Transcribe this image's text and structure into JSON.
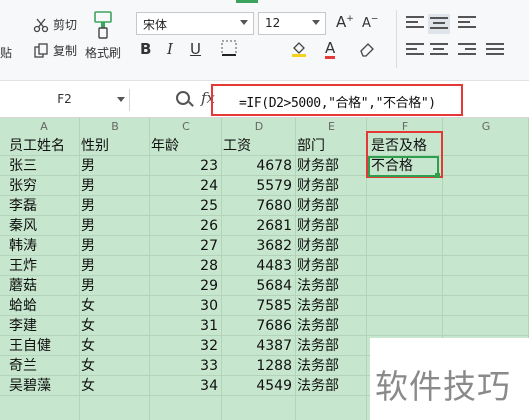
{
  "ribbon": {
    "paste_label": "贴",
    "cut_label": "剪切",
    "copy_label": "复制",
    "format_painter_label": "格式刷",
    "font_name": "宋体",
    "font_size": "12",
    "accent_color": "#e53935",
    "green_accent": "#3ca35c"
  },
  "formula_bar": {
    "name_box": "F2",
    "fx_label": "fx",
    "formula": "=IF(D2>5000,\"合格\",\"不合格\")"
  },
  "columns": [
    "A",
    "B",
    "C",
    "D",
    "E",
    "F",
    "G"
  ],
  "table": {
    "headers": [
      "员工姓名",
      "性别",
      "年龄",
      "工资",
      "部门",
      "是否及格"
    ],
    "rows": [
      [
        "张三",
        "男",
        "23",
        "4678",
        "财务部",
        "不合格"
      ],
      [
        "张穷",
        "男",
        "24",
        "5579",
        "财务部",
        ""
      ],
      [
        "李磊",
        "男",
        "25",
        "7680",
        "财务部",
        ""
      ],
      [
        "秦风",
        "男",
        "26",
        "2681",
        "财务部",
        ""
      ],
      [
        "韩涛",
        "男",
        "27",
        "3682",
        "财务部",
        ""
      ],
      [
        "王炸",
        "男",
        "28",
        "4483",
        "财务部",
        ""
      ],
      [
        "蘑菇",
        "男",
        "29",
        "5684",
        "法务部",
        ""
      ],
      [
        "蛤蛤",
        "女",
        "30",
        "7585",
        "法务部",
        ""
      ],
      [
        "李建",
        "女",
        "31",
        "7686",
        "法务部",
        ""
      ],
      [
        "王自健",
        "女",
        "32",
        "4387",
        "法务部",
        ""
      ],
      [
        "奇兰",
        "女",
        "33",
        "1288",
        "法务部",
        ""
      ],
      [
        "吴碧藻",
        "女",
        "34",
        "4549",
        "法务部",
        ""
      ]
    ]
  },
  "watermark": "软件技巧"
}
